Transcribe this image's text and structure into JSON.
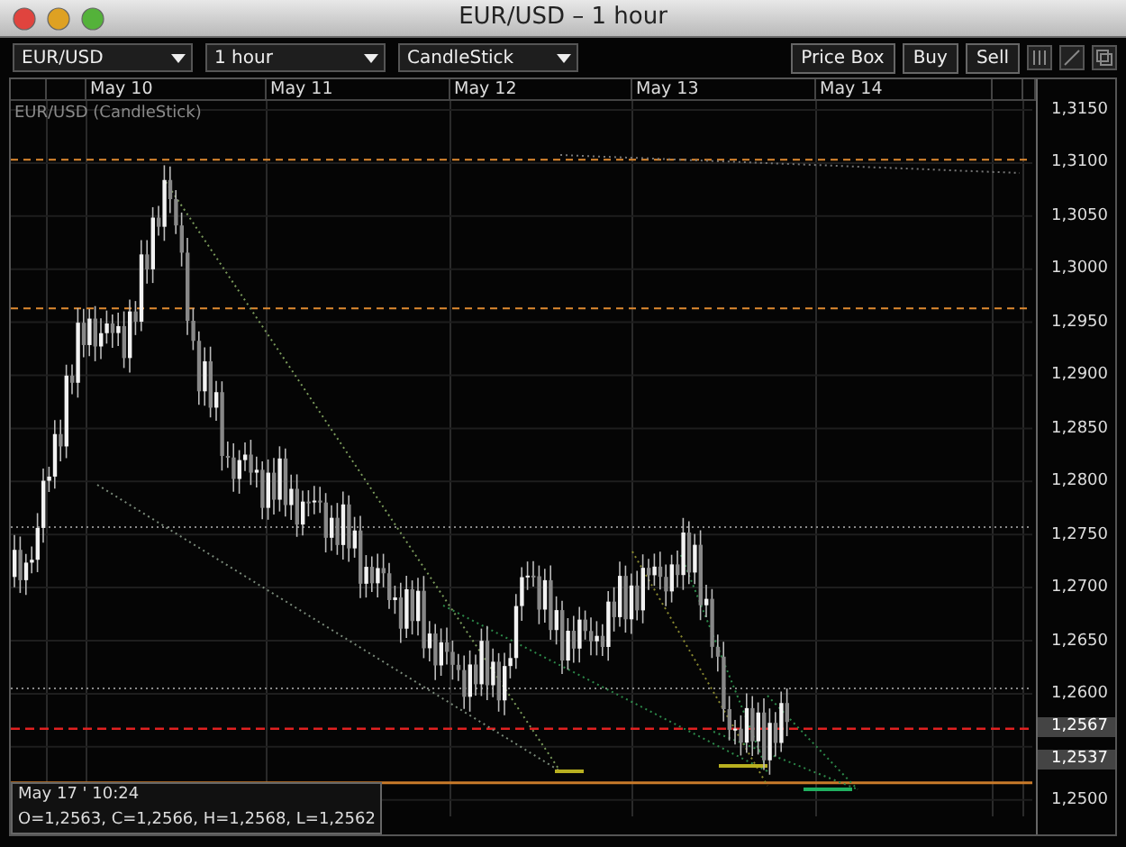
{
  "window": {
    "title": "EUR/USD – 1 hour"
  },
  "toolbar": {
    "symbol": "EUR/USD",
    "interval": "1 hour",
    "chart_type": "CandleStick",
    "buttons": [
      "Price Box",
      "Buy",
      "Sell"
    ]
  },
  "chart": {
    "legend": "EUR/USD (CandleStick)",
    "dates": [
      "May 10",
      "May 11",
      "May 12",
      "May 13",
      "May 14"
    ],
    "price_labels": [
      "1,3150",
      "1,3100",
      "1,3050",
      "1,3000",
      "1,2950",
      "1,2900",
      "1,2850",
      "1,2800",
      "1,2750",
      "1,2700",
      "1,2650",
      "1,2600",
      "1,2567",
      "1,2537",
      "1,2500"
    ],
    "info": {
      "time": "May 17 ' 10:24",
      "ohlc": "O=1,2563, C=1,2566, H=1,2568, L=1,2562"
    }
  }
}
